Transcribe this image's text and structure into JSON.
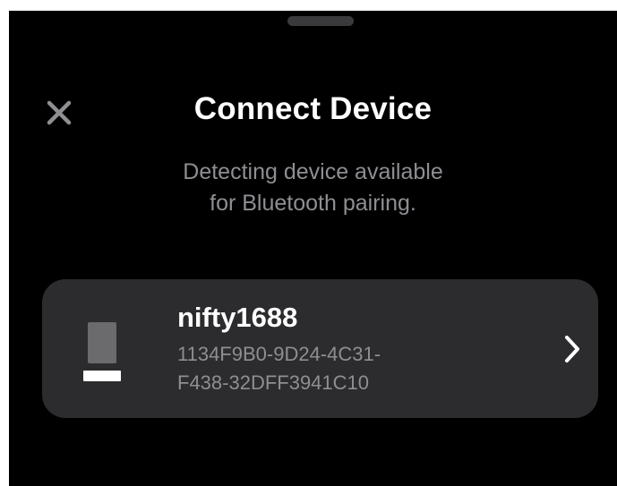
{
  "sheet": {
    "title": "Connect Device",
    "subtitle_line1": "Detecting device available",
    "subtitle_line2": "for Bluetooth pairing.",
    "close_icon": "close-icon"
  },
  "device": {
    "name": "nifty1688",
    "uuid_line1": "1134F9B0-9D24-4C31-",
    "uuid_line2": "F438-32DFF3941C10",
    "icon": "device-icon",
    "chevron_icon": "chevron-right-icon"
  },
  "colors": {
    "background": "#000000",
    "card": "#2c2c2e",
    "secondary_text": "#8e8e93",
    "primary_text": "#ffffff"
  }
}
